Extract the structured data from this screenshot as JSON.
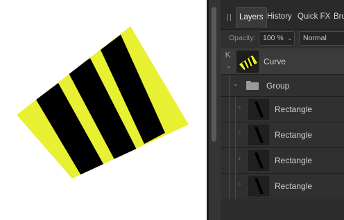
{
  "panel": {
    "tabs": [
      {
        "label": "Layers",
        "active": true
      },
      {
        "label": "History",
        "active": false
      },
      {
        "label": "Quick FX",
        "active": false
      },
      {
        "label": "Bru",
        "active": false
      }
    ],
    "opacity_label": "Opacity:",
    "opacity_value": "100 %",
    "blend_mode": "Normal"
  },
  "layers": [
    {
      "name": "Curve",
      "icon": "curve-thumbnail",
      "selected": true
    },
    {
      "name": "Group",
      "icon": "folder-icon",
      "collapsed": true
    },
    {
      "name": "Rectangle",
      "icon": "rectangle-thumbnail"
    },
    {
      "name": "Rectangle",
      "icon": "rectangle-thumbnail"
    },
    {
      "name": "Rectangle",
      "icon": "rectangle-thumbnail"
    },
    {
      "name": "Rectangle",
      "icon": "rectangle-thumbnail"
    }
  ],
  "colors": {
    "shape_fill": "#e8f032",
    "stripe": "#000000",
    "canvas_bg": "#ffffff",
    "panel_bg": "#303030"
  }
}
